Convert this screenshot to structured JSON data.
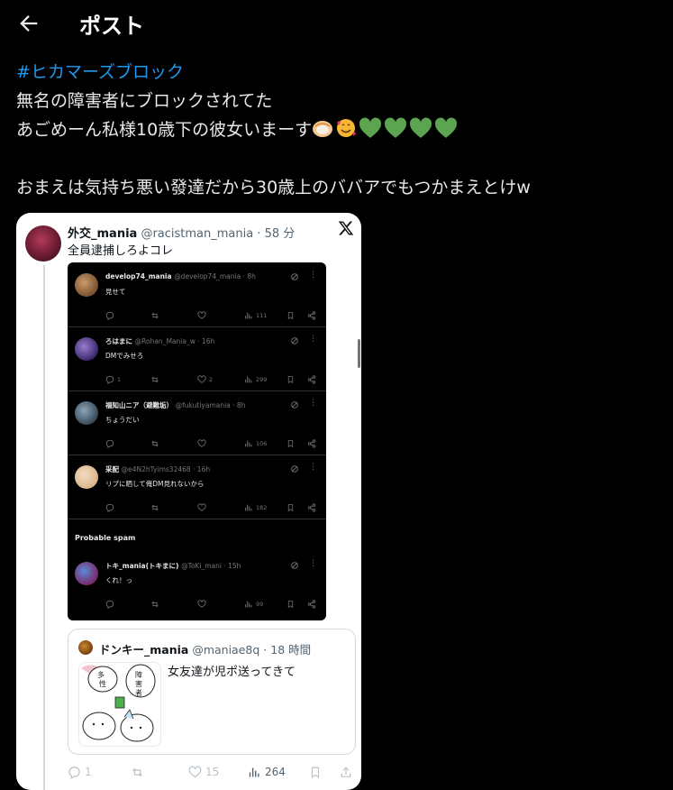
{
  "header": {
    "title": "ポスト"
  },
  "tweet": {
    "hashtag": "#ヒカマーズブロック",
    "line1": "無名の障害者にブロックされてた",
    "line2": "あごめーん私様10歳下の彼女いまーす",
    "line2_emojis": [
      "oyster-icon",
      "smiling-face-with-hearts-icon",
      "green-heart-icon",
      "green-heart-icon",
      "green-heart-icon",
      "green-heart-icon"
    ],
    "line3": "おまえは気持ち悪い發達だから30歳上のババアでもつかまえとけw"
  },
  "embed": {
    "name": "外交_mania",
    "handle": "@racistman_mania",
    "time": "· 58 分",
    "text": "全員逮捕しろよコレ",
    "screenshot": {
      "replies": [
        {
          "name": "develop74_mania",
          "handle": "@develop74_mania · 8h",
          "text": "見せて",
          "likes": "",
          "views": "111"
        },
        {
          "name": "ろはまに",
          "handle": "@Rohan_Mania_w · 16h",
          "text": "DMでみせろ",
          "replies": "1",
          "likes": "2",
          "views": "299"
        },
        {
          "name": "福知山ニア（避難垢）",
          "handle": "@fukutiyamania · 8h",
          "text": "ちょうだい",
          "likes": "",
          "views": "106"
        },
        {
          "name": "采配",
          "handle": "@e4N2hTyims32468 · 16h",
          "text": "リプに晒して俺DM見れないから",
          "likes": "",
          "views": "182"
        }
      ],
      "probable_label": "Probable spam",
      "spam_reply": {
        "name": "トキ_mania(トキまに)",
        "handle": "@ToKi_mani · 15h",
        "text": "くれ！っ",
        "views": "99"
      }
    },
    "quote": {
      "name": "ドンキー_mania",
      "handle": "@maniae8q",
      "time": "· 18 時間",
      "text": "女友達が児ポ送ってきて"
    },
    "actions": {
      "replies": "1",
      "likes": "15",
      "views": "264"
    }
  },
  "colors": {
    "accent": "#1d9bf0",
    "background": "#000000",
    "green_heart": "#5ca450"
  }
}
